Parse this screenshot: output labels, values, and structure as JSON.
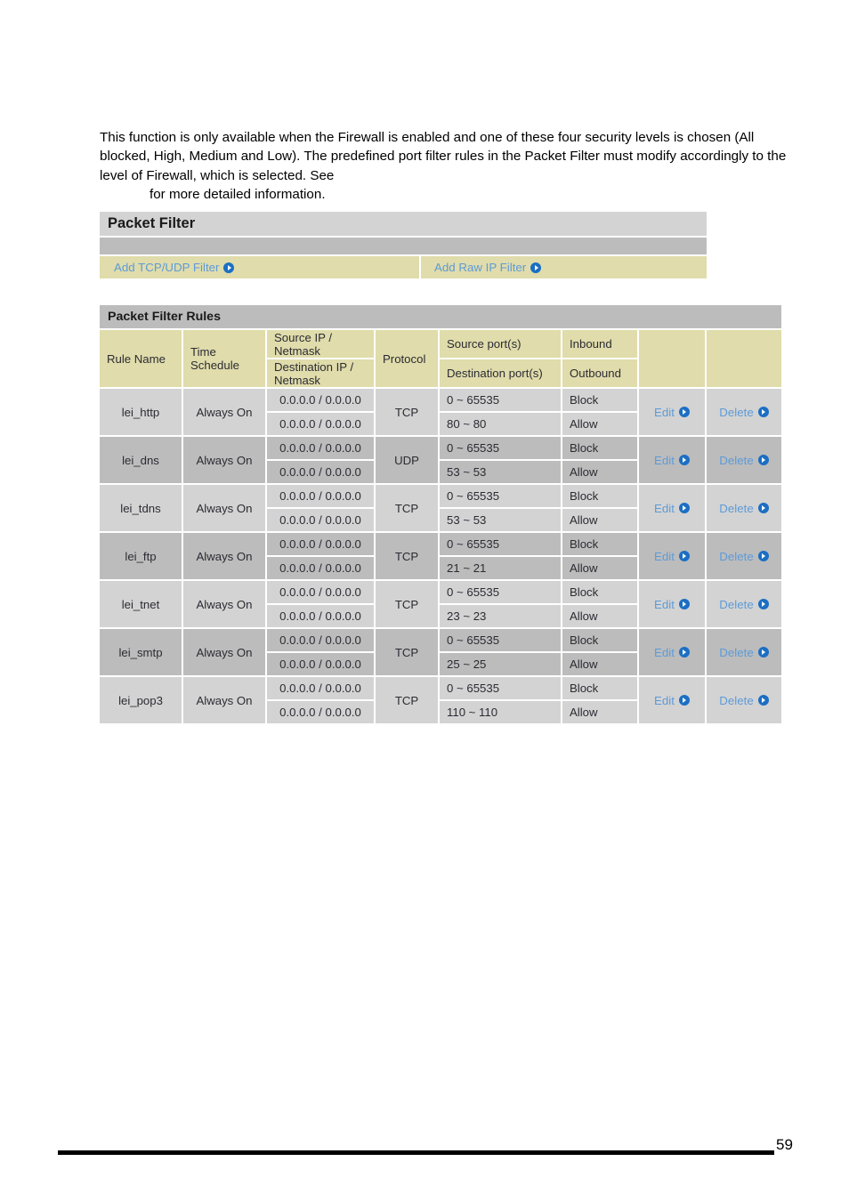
{
  "document": {
    "intro_lines": [
      "This function is only available when the Firewall is enabled and one of these four security levels is chosen (All blocked, High, Medium and Low).  The predefined port filter rules in the Packet Filter must modify accordingly to the level of Firewall, which is selected.  See",
      "for more detailed information."
    ],
    "page_number": "59"
  },
  "panel": {
    "title": "Packet Filter",
    "add_tcp_udp_label": "Add TCP/UDP Filter",
    "add_raw_ip_label": "Add Raw IP Filter",
    "arrow_icon": "circle-arrow-right-icon",
    "link_color": "#5d9bd8",
    "icon_color": "#1b6fc4",
    "header_bg": "#d3d3d3",
    "subbar_bg": "#bcbcbc",
    "link_row_bg": "#e0dcab"
  },
  "rules_table": {
    "title": "Packet Filter Rules",
    "headers": {
      "rule_name": "Rule Name",
      "time_schedule": "Time Schedule",
      "source_ip": "Source IP / Netmask",
      "destination_ip": "Destination IP / Netmask",
      "protocol": "Protocol",
      "source_port": "Source port(s)",
      "destination_port": "Destination port(s)",
      "inbound": "Inbound",
      "outbound": "Outbound",
      "edit_col": "",
      "delete_col": ""
    },
    "actions": {
      "edit": "Edit",
      "delete": "Delete"
    },
    "rows": [
      {
        "rule_name": "lei_http",
        "time_schedule": "Always On",
        "source_ip": "0.0.0.0 / 0.0.0.0",
        "destination_ip": "0.0.0.0 / 0.0.0.0",
        "protocol": "TCP",
        "source_port": "0 ~ 65535",
        "destination_port": "80 ~ 80",
        "inbound": "Block",
        "outbound": "Allow"
      },
      {
        "rule_name": "lei_dns",
        "time_schedule": "Always On",
        "source_ip": "0.0.0.0 / 0.0.0.0",
        "destination_ip": "0.0.0.0 / 0.0.0.0",
        "protocol": "UDP",
        "source_port": "0 ~ 65535",
        "destination_port": "53 ~ 53",
        "inbound": "Block",
        "outbound": "Allow"
      },
      {
        "rule_name": "lei_tdns",
        "time_schedule": "Always On",
        "source_ip": "0.0.0.0 / 0.0.0.0",
        "destination_ip": "0.0.0.0 / 0.0.0.0",
        "protocol": "TCP",
        "source_port": "0 ~ 65535",
        "destination_port": "53 ~ 53",
        "inbound": "Block",
        "outbound": "Allow"
      },
      {
        "rule_name": "lei_ftp",
        "time_schedule": "Always On",
        "source_ip": "0.0.0.0 / 0.0.0.0",
        "destination_ip": "0.0.0.0 / 0.0.0.0",
        "protocol": "TCP",
        "source_port": "0 ~ 65535",
        "destination_port": "21 ~ 21",
        "inbound": "Block",
        "outbound": "Allow"
      },
      {
        "rule_name": "lei_tnet",
        "time_schedule": "Always On",
        "source_ip": "0.0.0.0 / 0.0.0.0",
        "destination_ip": "0.0.0.0 / 0.0.0.0",
        "protocol": "TCP",
        "source_port": "0 ~ 65535",
        "destination_port": "23 ~ 23",
        "inbound": "Block",
        "outbound": "Allow"
      },
      {
        "rule_name": "lei_smtp",
        "time_schedule": "Always On",
        "source_ip": "0.0.0.0 / 0.0.0.0",
        "destination_ip": "0.0.0.0 / 0.0.0.0",
        "protocol": "TCP",
        "source_port": "0 ~ 65535",
        "destination_port": "25 ~ 25",
        "inbound": "Block",
        "outbound": "Allow"
      },
      {
        "rule_name": "lei_pop3",
        "time_schedule": "Always On",
        "source_ip": "0.0.0.0 / 0.0.0.0",
        "destination_ip": "0.0.0.0 / 0.0.0.0",
        "protocol": "TCP",
        "source_port": "0 ~ 65535",
        "destination_port": "110 ~ 110",
        "inbound": "Block",
        "outbound": "Allow"
      }
    ]
  }
}
